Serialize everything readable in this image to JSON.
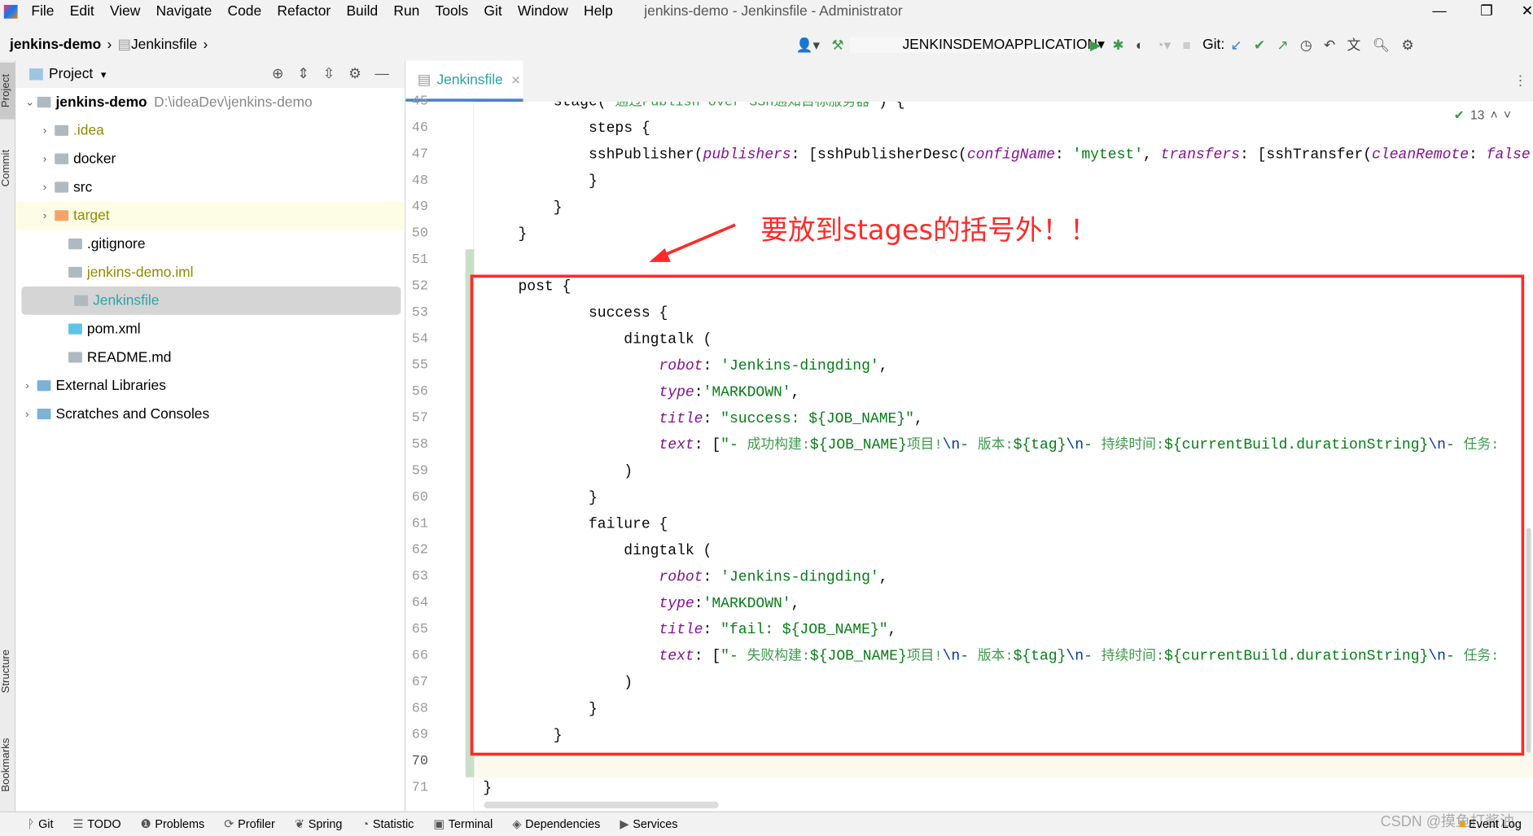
{
  "menu": {
    "items": [
      "File",
      "Edit",
      "View",
      "Navigate",
      "Code",
      "Refactor",
      "Build",
      "Run",
      "Tools",
      "Git",
      "Window",
      "Help"
    ],
    "title": "jenkins-demo - Jenkinsfile - Administrator"
  },
  "nav": {
    "breadcrumb": [
      "jenkins-demo",
      "Jenkinsfile"
    ],
    "run_config": "JENKINSDEMOAPPLICATION",
    "git_label": "Git:"
  },
  "side_stripe": {
    "project": "Project",
    "commit": "Commit",
    "structure": "Structure",
    "bookmarks": "Bookmarks"
  },
  "project": {
    "title": "Project",
    "tree": [
      {
        "label": "jenkins-demo",
        "path": "D:\\ideaDev\\jenkins-demo",
        "level": 0,
        "expanded": true,
        "icon": "module-folder-icon",
        "color": "#000"
      },
      {
        "label": ".idea",
        "level": 1,
        "icon": "folder-icon",
        "color": "#8c8c00"
      },
      {
        "label": "docker",
        "level": 1,
        "icon": "folder-icon",
        "color": "#000"
      },
      {
        "label": "src",
        "level": 1,
        "icon": "folder-icon",
        "color": "#000"
      },
      {
        "label": "target",
        "level": 1,
        "icon": "excluded-folder-icon",
        "color": "#8c8c00",
        "highlight": true
      },
      {
        "label": ".gitignore",
        "level": 2,
        "icon": "gitignore-file-icon",
        "color": "#000"
      },
      {
        "label": "jenkins-demo.iml",
        "level": 2,
        "icon": "iml-file-icon",
        "color": "#8c8c00"
      },
      {
        "label": "Jenkinsfile",
        "level": 2,
        "icon": "text-file-icon",
        "color": "#2ba3a6",
        "selected": true
      },
      {
        "label": "pom.xml",
        "level": 2,
        "icon": "maven-icon",
        "color": "#000"
      },
      {
        "label": "README.md",
        "level": 2,
        "icon": "markdown-file-icon",
        "color": "#000"
      },
      {
        "label": "External Libraries",
        "level": 0,
        "icon": "libraries-icon",
        "color": "#000"
      },
      {
        "label": "Scratches and Consoles",
        "level": 0,
        "icon": "scratches-icon",
        "color": "#000"
      }
    ]
  },
  "editor": {
    "tab": "Jenkinsfile",
    "inspection_count": "13",
    "lines": [
      {
        "n": 45,
        "i": 8,
        "t": [
          [
            "stage('",
            ""
          ],
          [
            "通过Publish over SSH通知目标服务器",
            "z"
          ],
          [
            "') {",
            ""
          ]
        ]
      },
      {
        "n": 46,
        "i": 12,
        "t": [
          [
            "steps {",
            ""
          ]
        ]
      },
      {
        "n": 47,
        "i": 12,
        "t": [
          [
            "sshPublisher(",
            ""
          ],
          [
            "publishers",
            "p"
          ],
          [
            ": [sshPublisherDesc(",
            ""
          ],
          [
            "configName",
            "p"
          ],
          [
            ": ",
            ""
          ],
          [
            "'mytest'",
            "s"
          ],
          [
            ", ",
            ""
          ],
          [
            "transfers",
            "p"
          ],
          [
            ": [sshTransfer(",
            ""
          ],
          [
            "cleanRemote",
            "p"
          ],
          [
            ": ",
            ""
          ],
          [
            "false",
            "p"
          ]
        ]
      },
      {
        "n": 48,
        "i": 12,
        "t": [
          [
            "}",
            ""
          ]
        ]
      },
      {
        "n": 49,
        "i": 8,
        "t": [
          [
            "}",
            ""
          ]
        ]
      },
      {
        "n": 50,
        "i": 4,
        "t": [
          [
            "}",
            ""
          ]
        ]
      },
      {
        "n": 51,
        "i": 0,
        "t": []
      },
      {
        "n": 52,
        "i": 4,
        "t": [
          [
            "post {",
            ""
          ]
        ]
      },
      {
        "n": 53,
        "i": 12,
        "t": [
          [
            "success {",
            ""
          ]
        ]
      },
      {
        "n": 54,
        "i": 16,
        "t": [
          [
            "dingtalk (",
            ""
          ]
        ]
      },
      {
        "n": 55,
        "i": 20,
        "t": [
          [
            "robot",
            "p"
          ],
          [
            ": ",
            ""
          ],
          [
            "'Jenkins-dingding'",
            "s"
          ],
          [
            ",",
            ""
          ]
        ]
      },
      {
        "n": 56,
        "i": 20,
        "t": [
          [
            "type",
            "p"
          ],
          [
            ":",
            ""
          ],
          [
            "'MARKDOWN'",
            "s"
          ],
          [
            ",",
            ""
          ]
        ]
      },
      {
        "n": 57,
        "i": 20,
        "t": [
          [
            "title",
            "p"
          ],
          [
            ": ",
            ""
          ],
          [
            "\"success: ${JOB_NAME}\"",
            "s"
          ],
          [
            ",",
            ""
          ]
        ]
      },
      {
        "n": 58,
        "i": 20,
        "t": [
          [
            "text",
            "p"
          ],
          [
            ": [",
            ""
          ],
          [
            "\"- ",
            "s"
          ],
          [
            "成功构建:",
            "z"
          ],
          [
            "${JOB_NAME}",
            "s"
          ],
          [
            "项目!",
            "z"
          ],
          [
            "\\n",
            "e"
          ],
          [
            "- ",
            "s"
          ],
          [
            "版本:",
            "z"
          ],
          [
            "${tag}",
            "s"
          ],
          [
            "\\n",
            "e"
          ],
          [
            "- ",
            "s"
          ],
          [
            "持续时间:",
            "z"
          ],
          [
            "${currentBuild.durationString}",
            "s"
          ],
          [
            "\\n",
            "e"
          ],
          [
            "- ",
            "s"
          ],
          [
            "任务:",
            "z"
          ]
        ]
      },
      {
        "n": 59,
        "i": 16,
        "t": [
          [
            ")",
            ""
          ]
        ]
      },
      {
        "n": 60,
        "i": 12,
        "t": [
          [
            "}",
            ""
          ]
        ]
      },
      {
        "n": 61,
        "i": 12,
        "t": [
          [
            "failure {",
            ""
          ]
        ]
      },
      {
        "n": 62,
        "i": 16,
        "t": [
          [
            "dingtalk (",
            ""
          ]
        ]
      },
      {
        "n": 63,
        "i": 20,
        "t": [
          [
            "robot",
            "p"
          ],
          [
            ": ",
            ""
          ],
          [
            "'Jenkins-dingding'",
            "s"
          ],
          [
            ",",
            ""
          ]
        ]
      },
      {
        "n": 64,
        "i": 20,
        "t": [
          [
            "type",
            "p"
          ],
          [
            ":",
            ""
          ],
          [
            "'MARKDOWN'",
            "s"
          ],
          [
            ",",
            ""
          ]
        ]
      },
      {
        "n": 65,
        "i": 20,
        "t": [
          [
            "title",
            "p"
          ],
          [
            ": ",
            ""
          ],
          [
            "\"fail: ${JOB_NAME}\"",
            "s"
          ],
          [
            ",",
            ""
          ]
        ]
      },
      {
        "n": 66,
        "i": 20,
        "t": [
          [
            "text",
            "p"
          ],
          [
            ": [",
            ""
          ],
          [
            "\"- ",
            "s"
          ],
          [
            "失败构建:",
            "z"
          ],
          [
            "${JOB_NAME}",
            "s"
          ],
          [
            "项目!",
            "z"
          ],
          [
            "\\n",
            "e"
          ],
          [
            "- ",
            "s"
          ],
          [
            "版本:",
            "z"
          ],
          [
            "${tag}",
            "s"
          ],
          [
            "\\n",
            "e"
          ],
          [
            "- ",
            "s"
          ],
          [
            "持续时间:",
            "z"
          ],
          [
            "${currentBuild.durationString}",
            "s"
          ],
          [
            "\\n",
            "e"
          ],
          [
            "- ",
            "s"
          ],
          [
            "任务:",
            "z"
          ]
        ]
      },
      {
        "n": 67,
        "i": 16,
        "t": [
          [
            ")",
            ""
          ]
        ]
      },
      {
        "n": 68,
        "i": 12,
        "t": [
          [
            "}",
            ""
          ]
        ]
      },
      {
        "n": 69,
        "i": 8,
        "t": [
          [
            "}",
            ""
          ]
        ]
      },
      {
        "n": 70,
        "i": 0,
        "t": [],
        "current": true
      },
      {
        "n": 71,
        "i": 0,
        "t": [
          [
            "}",
            ""
          ]
        ]
      }
    ]
  },
  "annotation": {
    "text": "要放到stages的括号外！！",
    "color": "#ff2a2a"
  },
  "statusbar": {
    "items": [
      "Git",
      "TODO",
      "Problems",
      "Profiler",
      "Spring",
      "Statistic",
      "Terminal",
      "Dependencies",
      "Services"
    ],
    "event_log": "Event Log",
    "watermark": "CSDN @摸鱼打酱油"
  }
}
